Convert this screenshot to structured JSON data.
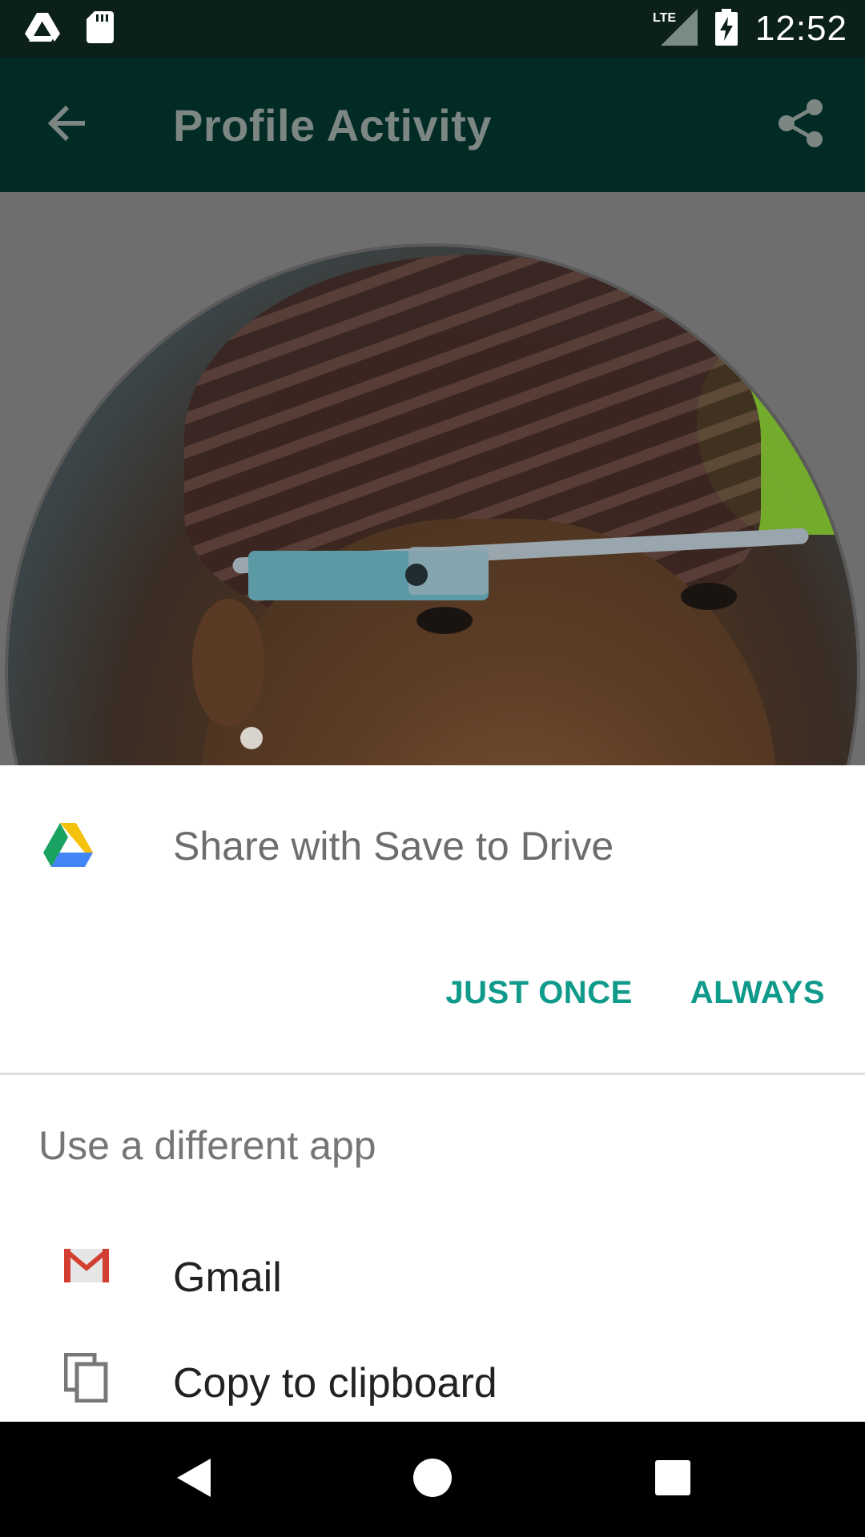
{
  "status_bar": {
    "time": "12:52",
    "network": "LTE",
    "icons": [
      "drive-notification-icon",
      "sd-card-icon",
      "lte-signal-icon",
      "battery-charging-icon"
    ]
  },
  "app_bar": {
    "title": "Profile Activity",
    "back_icon": "arrow-back-icon",
    "share_icon": "share-icon"
  },
  "profile": {
    "photo": "profile-photo"
  },
  "sheet": {
    "drive_title": "Share with Save to Drive",
    "just_once_label": "JUST ONCE",
    "always_label": "ALWAYS",
    "section_label": "Use a different app",
    "apps": [
      {
        "label": "Gmail",
        "icon": "gmail-icon"
      },
      {
        "label": "Copy to clipboard",
        "icon": "copy-icon"
      }
    ]
  },
  "nav_bar": {
    "icons": [
      "nav-back-icon",
      "nav-home-icon",
      "nav-recents-icon"
    ]
  },
  "colors": {
    "status_bar": "#0b1f1b",
    "app_bar": "#032b26",
    "accent": "#0f9a8a",
    "sheet_bg": "#ffffff"
  }
}
